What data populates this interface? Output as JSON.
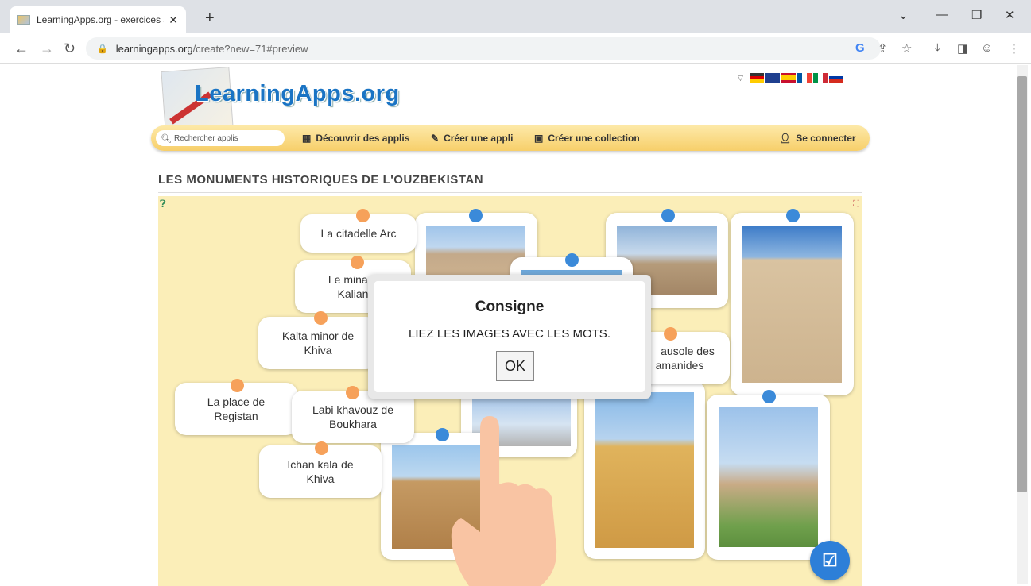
{
  "browser": {
    "tab_title": "LearningApps.org - exercices sco",
    "tab_close": "✕",
    "new_tab": "+",
    "url_host": "learningapps.org",
    "url_path": "/create?new=71#preview",
    "window_controls": [
      "⌄",
      "—",
      "❐",
      "✕"
    ]
  },
  "site": {
    "logo_text": "LearningApps.org",
    "search_placeholder": "Rechercher applis",
    "menu": {
      "discover": "Découvrir des applis",
      "create_app": "Créer une appli",
      "create_collection": "Créer une collection",
      "login": "Se connecter"
    },
    "flag_colors": [
      "#333333",
      "#1f3f8f",
      "#c8102e",
      "#0055a4",
      "#009246",
      "#d52b1e"
    ]
  },
  "app": {
    "title": "LES MONUMENTS HISTORIQUES DE L'OUZBEKISTAN",
    "words": [
      "La citadelle Arc",
      "Le minaret de Kalian",
      "Kalta minor de Khiva",
      "Mausolée des Samanides",
      "La place de Registan",
      "Labi khavouz de Boukhara",
      "Ichan kala de Khiva"
    ],
    "word_visible": {
      "w1": "La citadelle Arc",
      "w2a": "Le minare",
      "w2b": "Kalian",
      "w3a": "Kalta minor de",
      "w3b": "Khiva",
      "w4a": "ausole des",
      "w4b": "amanides",
      "w5a": "La place de",
      "w5b": "Registan",
      "w6a": "Labi khavouz de",
      "w6b": "Boukhara",
      "w7a": "Ichan kala de",
      "w7b": "Khiva"
    }
  },
  "dialog": {
    "title": "Consigne",
    "text": "LIEZ LES IMAGES AVEC LES MOTS.",
    "ok": "OK"
  },
  "colors": {
    "word_dot": "#f6a15a",
    "image_dot": "#3b8ad9",
    "app_background": "#fbeeb8",
    "menubar": "#f7cf6a",
    "logo_blue": "#1a74c4"
  }
}
